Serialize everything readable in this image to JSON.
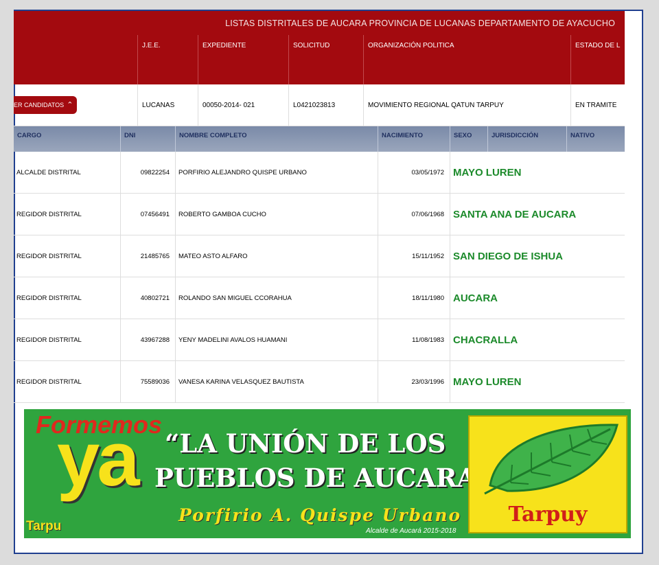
{
  "title": "LISTAS DISTRITALES DE AUCARA PROVINCIA DE LUCANAS DEPARTAMENTO DE AYACUCHO",
  "list_table": {
    "headers": [
      "",
      "J.E.E.",
      "EXPEDIENTE",
      "SOLICITUD",
      "ORGANIZACIÓN POLITICA",
      "ESTADO DE L"
    ],
    "row": {
      "button": "ER CANDIDATOS",
      "jee": "LUCANAS",
      "expediente": "00050-2014- 021",
      "solicitud": "L0421023813",
      "organizacion": "MOVIMIENTO REGIONAL QATUN TARPUY",
      "estado": "EN TRAMITE"
    }
  },
  "candidates": {
    "headers": [
      "CARGO",
      "DNI",
      "NOMBRE COMPLETO",
      "NACIMIENTO",
      "SEXO",
      "JURISDICCIÓN",
      "NATIVO"
    ],
    "rows": [
      {
        "cargo": "ALCALDE DISTRITAL",
        "dni": "09822254",
        "nombre": "PORFIRIO ALEJANDRO QUISPE URBANO",
        "nacimiento": "03/05/1972",
        "jurisdiccion": "MAYO LUREN"
      },
      {
        "cargo": "REGIDOR DISTRITAL",
        "dni": "07456491",
        "nombre": "ROBERTO GAMBOA CUCHO",
        "nacimiento": "07/06/1968",
        "jurisdiccion": "SANTA ANA DE AUCARA"
      },
      {
        "cargo": "REGIDOR DISTRITAL",
        "dni": "21485765",
        "nombre": "MATEO ASTO ALFARO",
        "nacimiento": "15/11/1952",
        "jurisdiccion": "SAN DIEGO DE ISHUA"
      },
      {
        "cargo": "REGIDOR DISTRITAL",
        "dni": "40802721",
        "nombre": "ROLANDO SAN MIGUEL CCORAHUA",
        "nacimiento": "18/11/1980",
        "jurisdiccion": "AUCARA"
      },
      {
        "cargo": "REGIDOR DISTRITAL",
        "dni": "43967288",
        "nombre": "YENY MADELINI AVALOS HUAMANI",
        "nacimiento": "11/08/1983",
        "jurisdiccion": "CHACRALLA"
      },
      {
        "cargo": "REGIDOR DISTRITAL",
        "dni": "75589036",
        "nombre": "VANESA KARINA VELASQUEZ BAUTISTA",
        "nacimiento": "23/03/1996",
        "jurisdiccion": "MAYO LUREN"
      }
    ]
  },
  "banner": {
    "formemos": "Formemos",
    "ya": "ya",
    "tarpu": "Tarpu",
    "slogan_line1": "“LA UNIÓN DE LOS",
    "slogan_line2": "PUEBLOS DE AUCARA”",
    "name": "Porfirio A. Quispe Urbano",
    "alcalde": "Alcalde de Aucará  2015-2018",
    "logo_text": "Tarpuy"
  },
  "colors": {
    "header_red": "#a30a0f",
    "banner_green": "#2fa43e",
    "logo_yellow": "#f7e21b",
    "jurisdiction_green": "#1b8a2a"
  }
}
